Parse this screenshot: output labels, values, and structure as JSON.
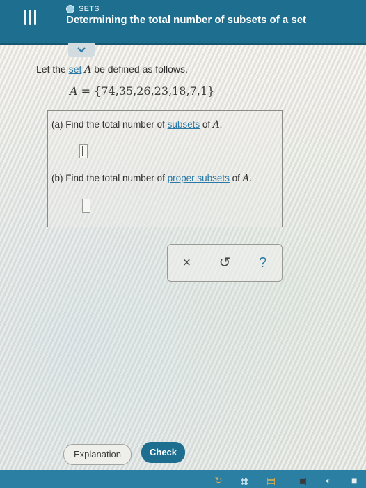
{
  "header": {
    "topic_label": "SETS",
    "title": "Determining the total number of subsets of a set",
    "menu_icon": "hamburger-vertical-icon",
    "collapse_icon": "chevron-down-icon"
  },
  "problem": {
    "intro_prefix": "Let the ",
    "intro_link": "set",
    "intro_var": "A",
    "intro_suffix": " be defined as follows.",
    "set_var": "A",
    "set_equals": " = ",
    "set_elements": "{74,35,26,23,18,7,1}"
  },
  "parts": {
    "a": {
      "prefix": "(a) Find the total number of ",
      "link": "subsets",
      "mid": " of ",
      "var": "A",
      "end": ".",
      "answer": ""
    },
    "b": {
      "prefix": "(b) Find the total number of ",
      "link": "proper subsets",
      "mid": " of ",
      "var": "A",
      "end": ".",
      "answer": ""
    }
  },
  "tools": {
    "clear": "×",
    "undo": "↺",
    "help": "?"
  },
  "footer": {
    "explanation_label": "Explanation",
    "check_label": "Check"
  },
  "colors": {
    "brand": "#1d6e8f",
    "link": "#2a78a6"
  }
}
